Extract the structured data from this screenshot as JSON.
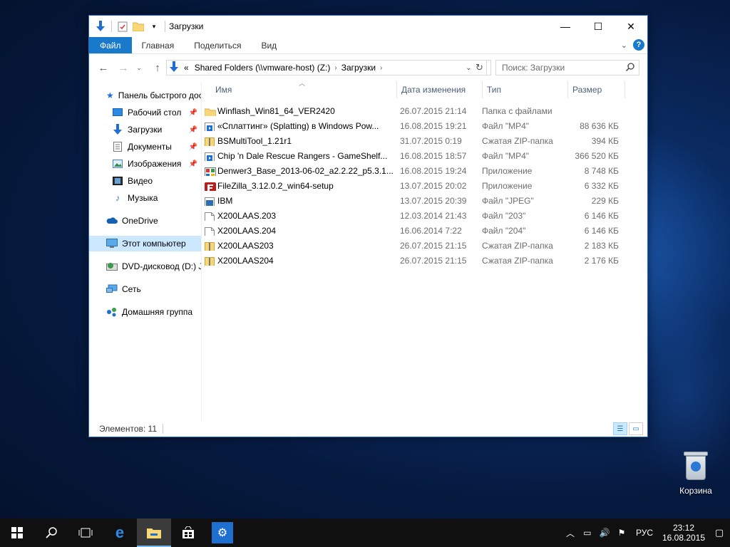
{
  "window": {
    "title": "Загрузки",
    "caption": {
      "minimize": "—",
      "maximize": "☐",
      "close": "✕"
    }
  },
  "ribbon": {
    "tabs": [
      "Файл",
      "Главная",
      "Поделиться",
      "Вид"
    ],
    "help": "?"
  },
  "address": {
    "prefix": "«",
    "crumbs": [
      "Shared Folders (\\\\vmware-host) (Z:)",
      "Загрузки"
    ]
  },
  "search": {
    "placeholder": "Поиск: Загрузки"
  },
  "nav_pane": {
    "items": [
      {
        "label": "Панель быстрого доступа",
        "icon": "star-icon",
        "pinned": false
      },
      {
        "label": "Рабочий стол",
        "icon": "desktop-icon",
        "pinned": true
      },
      {
        "label": "Загрузки",
        "icon": "download-icon",
        "pinned": true
      },
      {
        "label": "Документы",
        "icon": "documents-icon",
        "pinned": true
      },
      {
        "label": "Изображения",
        "icon": "pictures-icon",
        "pinned": true
      },
      {
        "label": "Видео",
        "icon": "video-icon",
        "pinned": false
      },
      {
        "label": "Музыка",
        "icon": "music-icon",
        "pinned": false
      },
      {
        "label": "OneDrive",
        "icon": "cloud-icon",
        "pinned": false
      },
      {
        "label": "Этот компьютер",
        "icon": "computer-icon",
        "pinned": false
      },
      {
        "label": "DVD-дисковод (D:) J_",
        "icon": "dvd-icon",
        "pinned": false
      },
      {
        "label": "Сеть",
        "icon": "network-icon",
        "pinned": false
      },
      {
        "label": "Домашняя группа",
        "icon": "homegroup-icon",
        "pinned": false
      }
    ]
  },
  "columns": {
    "name": "Имя",
    "date": "Дата изменения",
    "type": "Тип",
    "size": "Размер"
  },
  "files": [
    {
      "name": "Winflash_Win81_64_VER2420",
      "date": "26.07.2015 21:14",
      "type": "Папка с файлами",
      "size": "",
      "icon": "folder-icon"
    },
    {
      "name": "«Сплаттинг» (Splatting) в Windows Pow...",
      "date": "16.08.2015 19:21",
      "type": "Файл \"MP4\"",
      "size": "88 636 КБ",
      "icon": "video-file-icon"
    },
    {
      "name": "BSMultiTool_1.21r1",
      "date": "31.07.2015 0:19",
      "type": "Сжатая ZIP-папка",
      "size": "394 КБ",
      "icon": "zip-icon"
    },
    {
      "name": "Chip 'n Dale Rescue Rangers - GameShelf...",
      "date": "16.08.2015 18:57",
      "type": "Файл \"MP4\"",
      "size": "366 520 КБ",
      "icon": "video-file-icon"
    },
    {
      "name": "Denwer3_Base_2013-06-02_a2.2.22_p5.3.1...",
      "date": "16.08.2015 19:24",
      "type": "Приложение",
      "size": "8 748 КБ",
      "icon": "app-icon"
    },
    {
      "name": "FileZilla_3.12.0.2_win64-setup",
      "date": "13.07.2015 20:02",
      "type": "Приложение",
      "size": "6 332 КБ",
      "icon": "filezilla-icon"
    },
    {
      "name": "IBM",
      "date": "13.07.2015 20:39",
      "type": "Файл \"JPEG\"",
      "size": "229 КБ",
      "icon": "image-file-icon"
    },
    {
      "name": "X200LAAS.203",
      "date": "12.03.2014 21:43",
      "type": "Файл \"203\"",
      "size": "6 146 КБ",
      "icon": "blank-file-icon"
    },
    {
      "name": "X200LAAS.204",
      "date": "16.06.2014 7:22",
      "type": "Файл \"204\"",
      "size": "6 146 КБ",
      "icon": "blank-file-icon"
    },
    {
      "name": "X200LAAS203",
      "date": "26.07.2015 21:15",
      "type": "Сжатая ZIP-папка",
      "size": "2 183 КБ",
      "icon": "zip-icon"
    },
    {
      "name": "X200LAAS204",
      "date": "26.07.2015 21:15",
      "type": "Сжатая ZIP-папка",
      "size": "2 176 КБ",
      "icon": "zip-icon"
    }
  ],
  "status": {
    "count": "Элементов: 11"
  },
  "desktop": {
    "recycle_bin": "Корзина"
  },
  "taskbar": {
    "lang": "РУС",
    "time": "23:12",
    "date": "16.08.2015"
  },
  "colors": {
    "accent": "#1979ca",
    "selection": "#cce8ff",
    "taskbar": "#101010"
  }
}
